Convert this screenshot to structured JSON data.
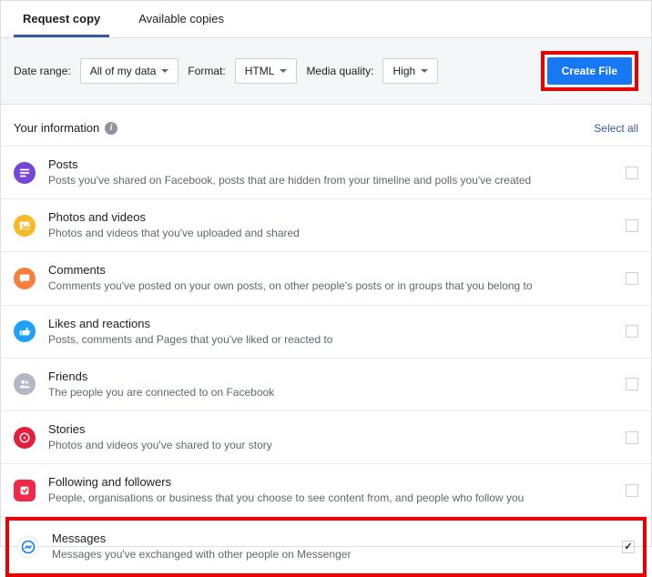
{
  "tabs": {
    "request": "Request copy",
    "available": "Available copies"
  },
  "filter": {
    "dateRangeLabel": "Date range:",
    "dateRangeValue": "All of my data",
    "formatLabel": "Format:",
    "formatValue": "HTML",
    "qualityLabel": "Media quality:",
    "qualityValue": "High",
    "createBtn": "Create File"
  },
  "section": {
    "title": "Your information",
    "selectAll": "Select all"
  },
  "items": [
    {
      "title": "Posts",
      "desc": "Posts you've shared on Facebook, posts that are hidden from your timeline and polls you've created",
      "checked": false
    },
    {
      "title": "Photos and videos",
      "desc": "Photos and videos that you've uploaded and shared",
      "checked": false
    },
    {
      "title": "Comments",
      "desc": "Comments you've posted on your own posts, on other people's posts or in groups that you belong to",
      "checked": false
    },
    {
      "title": "Likes and reactions",
      "desc": "Posts, comments and Pages that you've liked or reacted to",
      "checked": false
    },
    {
      "title": "Friends",
      "desc": "The people you are connected to on Facebook",
      "checked": false
    },
    {
      "title": "Stories",
      "desc": "Photos and videos you've shared to your story",
      "checked": false
    },
    {
      "title": "Following and followers",
      "desc": "People, organisations or business that you choose to see content from, and people who follow you",
      "checked": false
    },
    {
      "title": "Messages",
      "desc": "Messages you've exchanged with other people on Messenger",
      "checked": true
    }
  ]
}
